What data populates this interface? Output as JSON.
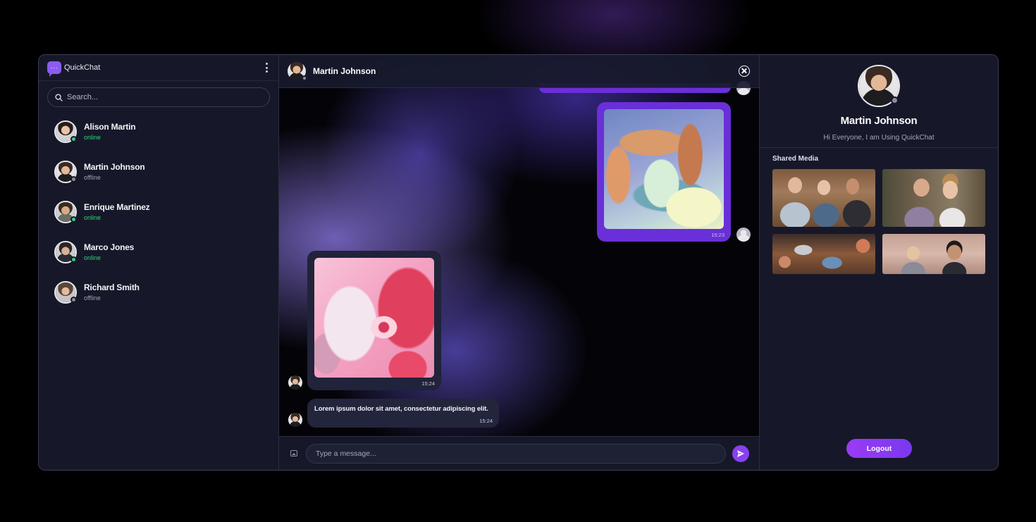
{
  "app": {
    "name": "QuickChat"
  },
  "sidebar": {
    "search_placeholder": "Search...",
    "contacts": [
      {
        "name": "Alison Martin",
        "status": "online"
      },
      {
        "name": "Martin Johnson",
        "status": "offline"
      },
      {
        "name": "Enrique Martinez",
        "status": "online"
      },
      {
        "name": "Marco Jones",
        "status": "online"
      },
      {
        "name": "Richard Smith",
        "status": "offline"
      }
    ]
  },
  "chat": {
    "contact_name": "Martin Johnson",
    "messages": [
      {
        "type": "image",
        "direction": "sent",
        "time": "15:23"
      },
      {
        "type": "image",
        "direction": "received",
        "time": "15:24"
      },
      {
        "type": "text",
        "direction": "received",
        "text": "Lorem ipsum dolor sit amet, consectetur adipiscing elit.",
        "time": "15:24"
      }
    ],
    "composer_placeholder": "Type a message..."
  },
  "profile": {
    "name": "Martin Johnson",
    "bio": "Hi Everyone, I am Using QuickChat",
    "shared_media_title": "Shared Media",
    "logout_label": "Logout"
  },
  "colors": {
    "accent": "#8840f0",
    "sent_bubble": "#6a2fd8",
    "online": "#2fd37a",
    "offline": "#a0a3b4",
    "panel": "#161829"
  },
  "icons": {
    "logo": "chat-bubble-icon",
    "menu": "kebab-menu-icon",
    "search": "search-icon",
    "close": "close-circle-icon",
    "attach": "image-icon",
    "send": "send-icon"
  }
}
